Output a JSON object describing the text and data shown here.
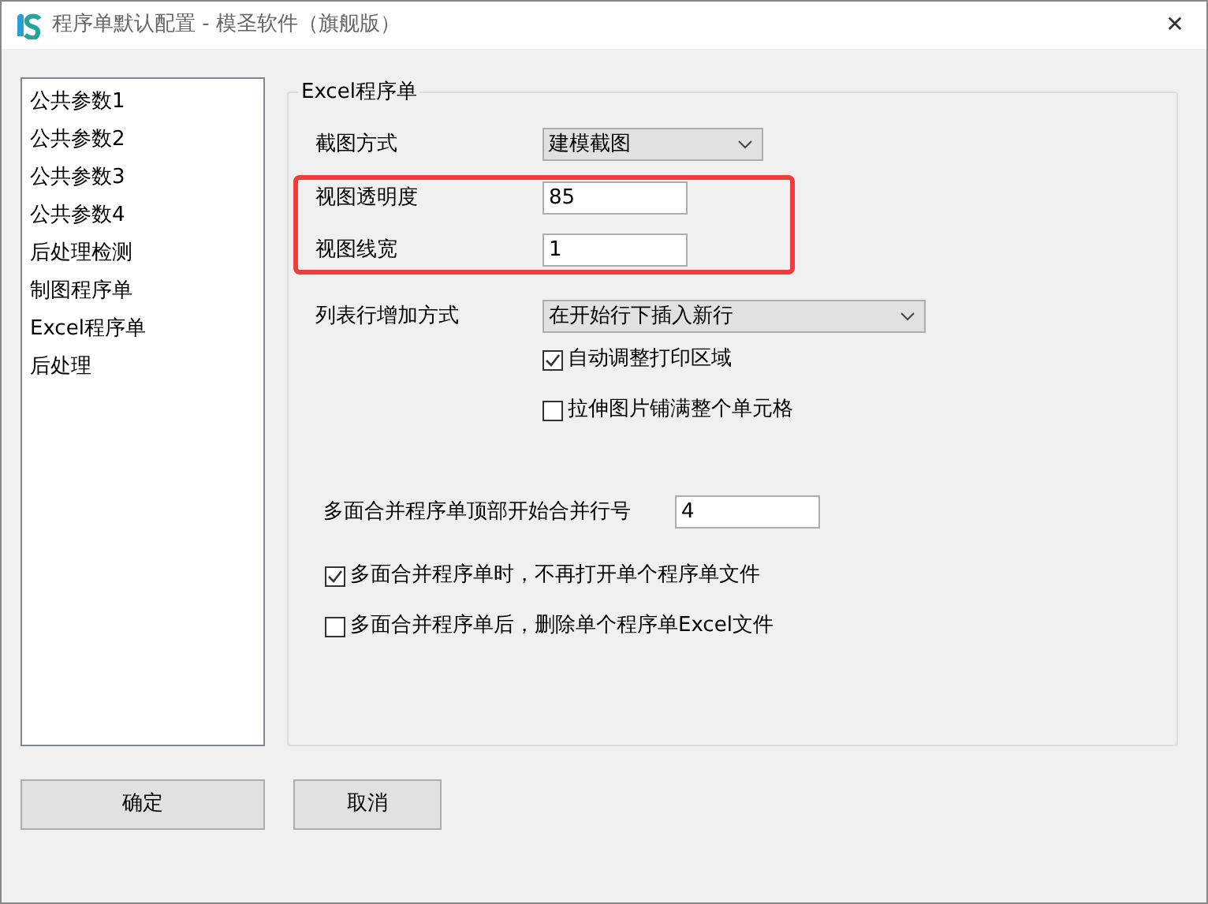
{
  "window": {
    "title": "程序单默认配置 - 模圣软件（旗舰版）",
    "close": "✕"
  },
  "sidebar": {
    "items": [
      {
        "label": "公共参数1",
        "selected": false
      },
      {
        "label": "公共参数2",
        "selected": false
      },
      {
        "label": "公共参数3",
        "selected": false
      },
      {
        "label": "公共参数4",
        "selected": false
      },
      {
        "label": "后处理检测",
        "selected": false
      },
      {
        "label": "制图程序单",
        "selected": false
      },
      {
        "label": "Excel程序单",
        "selected": false
      },
      {
        "label": "后处理",
        "selected": false
      }
    ]
  },
  "group": {
    "title": "Excel程序单",
    "screenshot_mode": {
      "label": "截图方式",
      "value": "建模截图"
    },
    "highlighted": true,
    "opacity": {
      "label": "视图透明度",
      "value": "85"
    },
    "line_width": {
      "label": "视图线宽",
      "value": "1"
    },
    "row_add_mode": {
      "label": "列表行增加方式",
      "value": "在开始行下插入新行"
    },
    "options": [
      {
        "label": "自动调整打印区域",
        "checked": true
      },
      {
        "label": "拉伸图片铺满整个单元格",
        "checked": false
      }
    ],
    "merge_start_row": {
      "label": "多面合并程序单顶部开始合并行号",
      "value": "4"
    },
    "merge_options": [
      {
        "label": "多面合并程序单时，不再打开单个程序单文件",
        "checked": true
      },
      {
        "label": "多面合并程序单后，删除单个程序单Excel文件",
        "checked": false
      }
    ]
  },
  "buttons": [
    {
      "label": "确定"
    },
    {
      "label": "取消"
    }
  ]
}
